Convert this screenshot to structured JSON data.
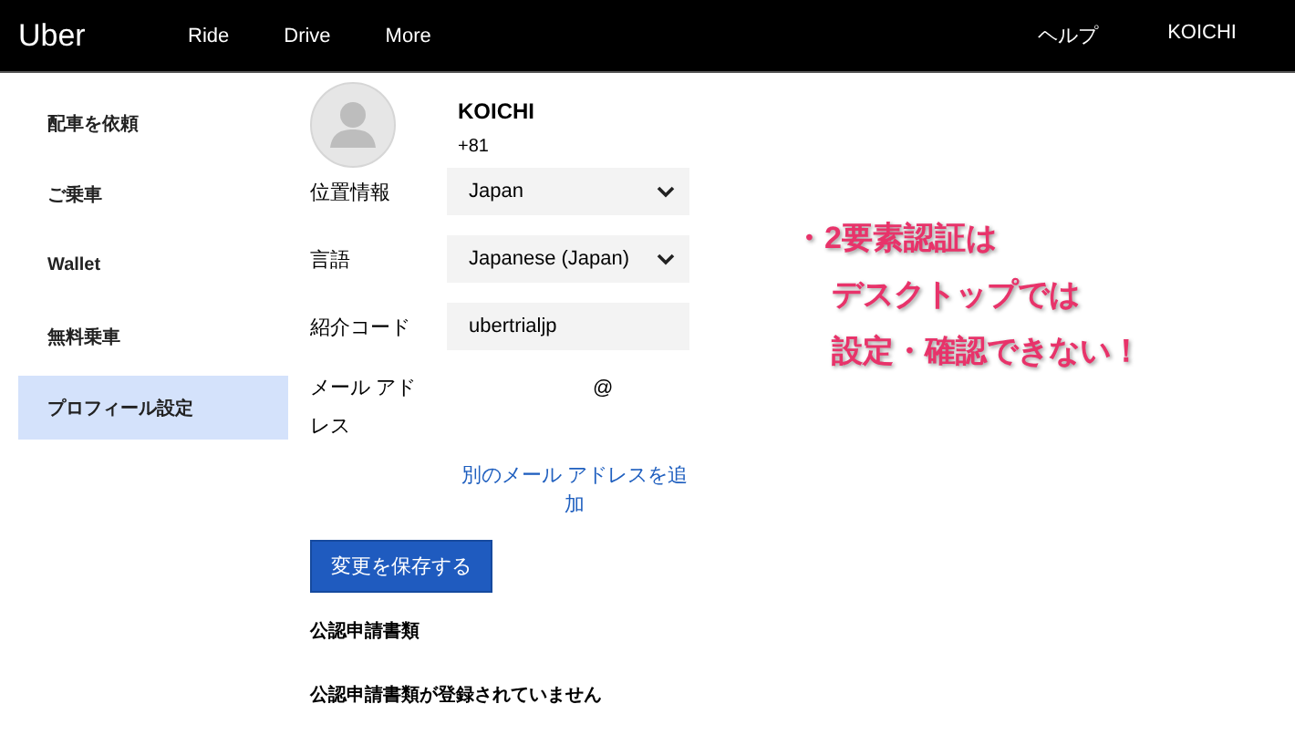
{
  "header": {
    "logo": "Uber",
    "nav": [
      {
        "label": "Ride"
      },
      {
        "label": "Drive"
      },
      {
        "label": "More"
      }
    ],
    "right": [
      "ヘルプ",
      "KOICHI"
    ]
  },
  "sidebar": {
    "items": [
      {
        "label": "配車を依頼",
        "selected": false
      },
      {
        "label": "ご乗車",
        "selected": false
      },
      {
        "label": "Wallet",
        "selected": false
      },
      {
        "label": "無料乗車",
        "selected": false
      },
      {
        "label": "プロフィール設定",
        "selected": true
      }
    ]
  },
  "profile": {
    "name": "KOICHI",
    "phone": "+81"
  },
  "fields": [
    {
      "kind": "select",
      "label": "位置情報",
      "value": "Japan"
    },
    {
      "kind": "select",
      "label": "言語",
      "value": "Japanese (Japan)"
    },
    {
      "kind": "text",
      "label": "紹介コード",
      "value": "ubertrialjp"
    }
  ],
  "email": {
    "label": "メール アドレス",
    "value": "@",
    "add_link": "別のメール アドレスを追加"
  },
  "save_button": "変更を保存する",
  "documents": {
    "heading": "公認申請書類",
    "note": "公認申請書類が登録されていません"
  },
  "annotation": {
    "lines": [
      "・2要素認証は",
      "デスクトップでは",
      "設定・確認できない！"
    ]
  }
}
